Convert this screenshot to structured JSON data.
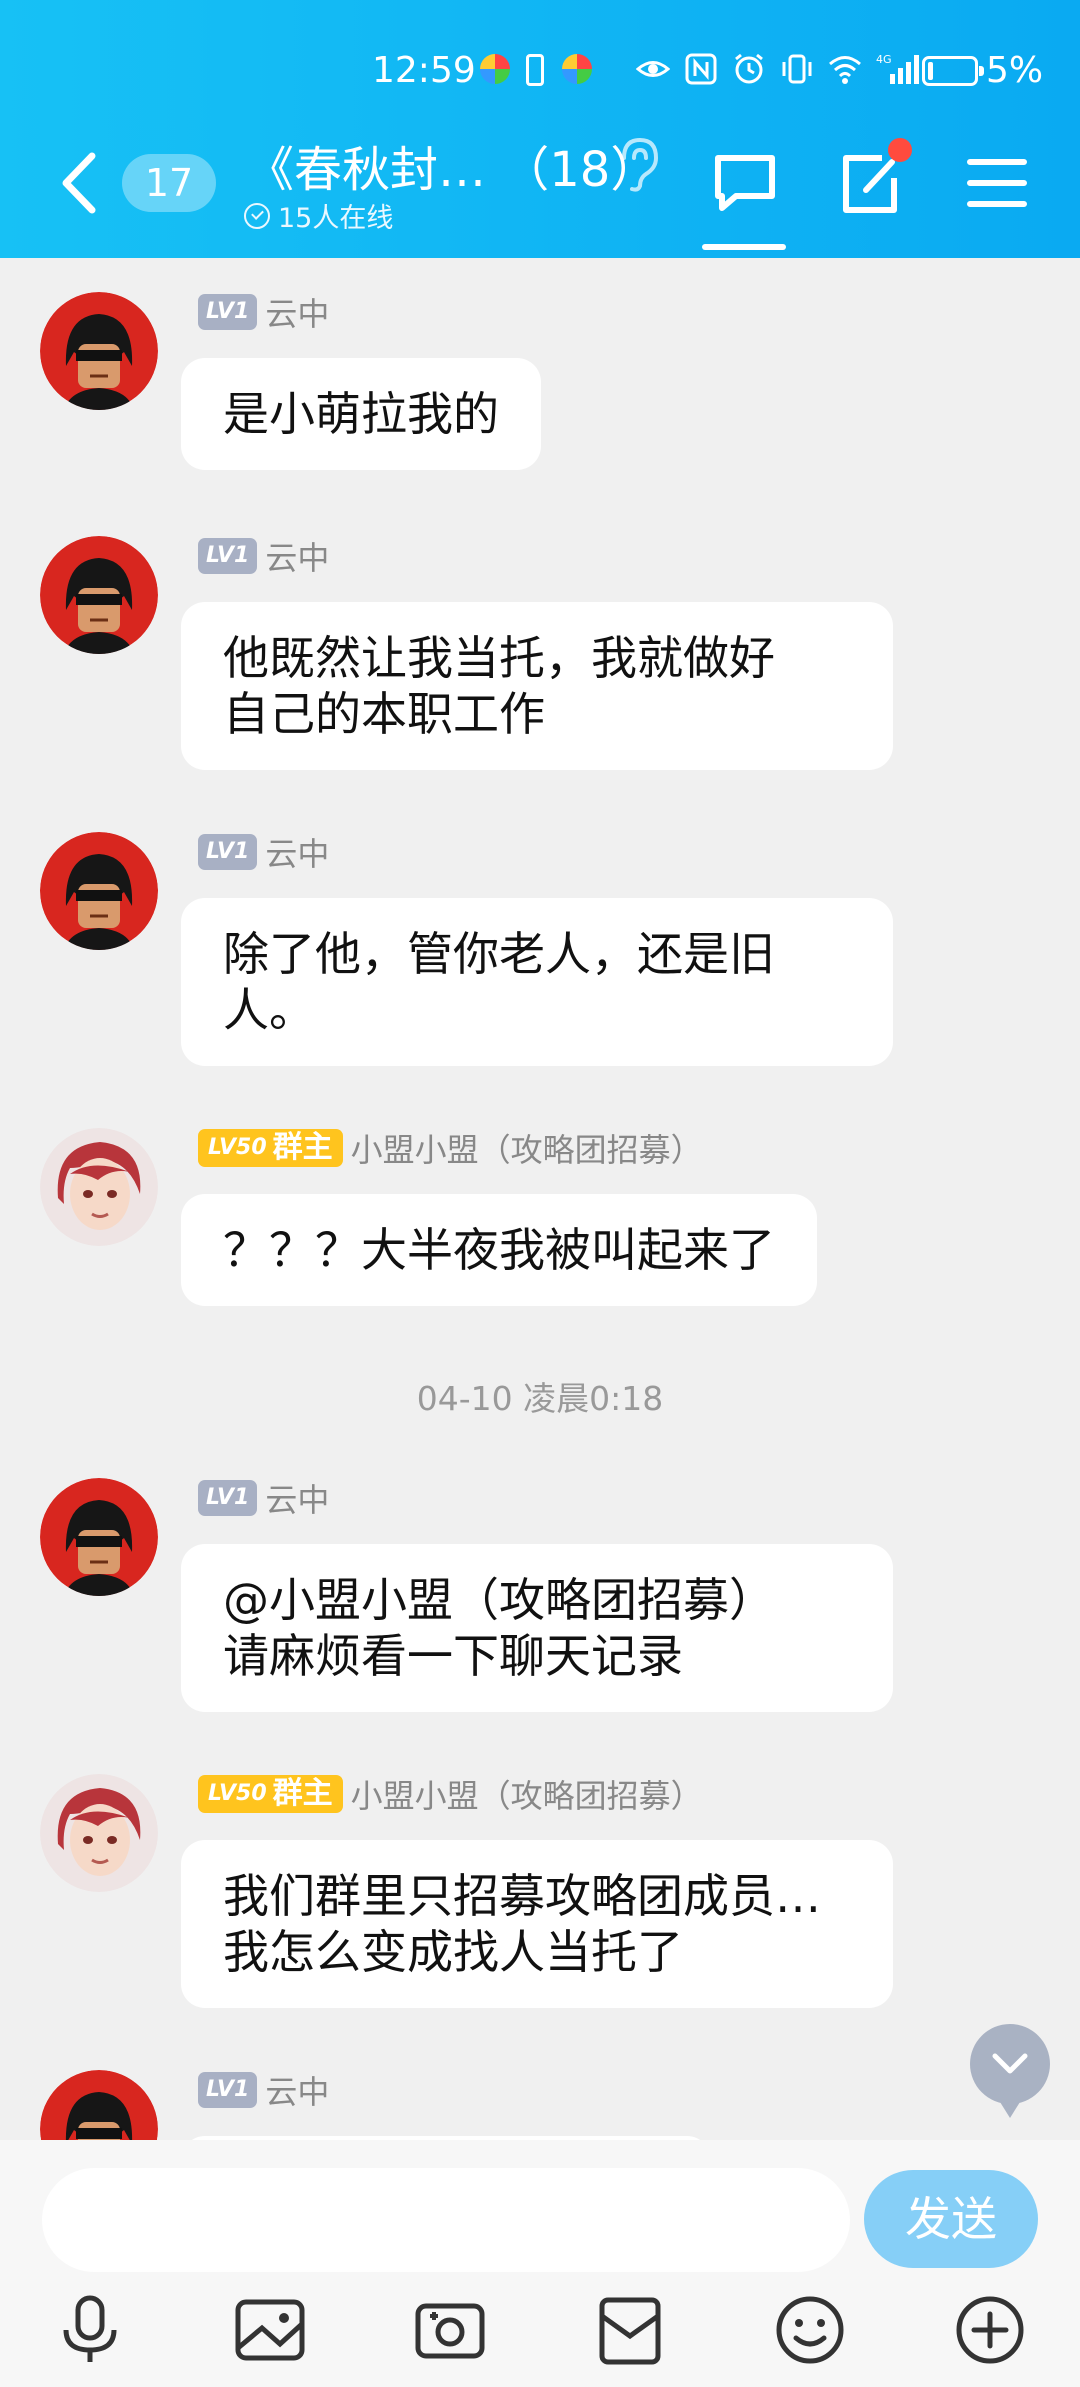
{
  "status_bar": {
    "time": "12:59",
    "battery": "5%",
    "network": "4G"
  },
  "header": {
    "unread_count": "17",
    "title": "《春秋封…  （18）",
    "online": "15人在线",
    "brand_color": "#12b7f5"
  },
  "messages": [
    {
      "type": "msg",
      "level": "LV1",
      "sender": "云中",
      "avatar": "pixel-avatar",
      "text": "是小萌拉我的"
    },
    {
      "type": "msg",
      "level": "LV1",
      "sender": "云中",
      "avatar": "pixel-avatar",
      "lines": [
        "他既然让我当托，我就做好",
        "自己的本职工作"
      ]
    },
    {
      "type": "msg",
      "level": "LV1",
      "sender": "云中",
      "avatar": "pixel-avatar",
      "lines": [
        "除了他，管你老人，还是旧",
        "人。"
      ]
    },
    {
      "type": "msg",
      "level": "LV50",
      "role": "群主",
      "sender": "小盟小盟（攻略团招募）",
      "avatar": "anime-avatar",
      "text": "？？？大半夜我被叫起来了"
    },
    {
      "type": "time",
      "text": "04-10 凌晨0:18"
    },
    {
      "type": "msg",
      "level": "LV1",
      "sender": "云中",
      "avatar": "pixel-avatar",
      "lines": [
        "@小盟小盟（攻略团招募）",
        "请麻烦看一下聊天记录"
      ]
    },
    {
      "type": "msg",
      "level": "LV50",
      "role": "群主",
      "sender": "小盟小盟（攻略团招募）",
      "avatar": "anime-avatar",
      "lines": [
        "我们群里只招募攻略团成员…",
        "我怎么变成找人当托了"
      ]
    },
    {
      "type": "msg",
      "level": "LV1",
      "sender": "云中",
      "avatar": "pixel-avatar"
    }
  ],
  "input": {
    "placeholder": "",
    "send_label": "发送"
  },
  "toolbar": [
    "microphone-icon",
    "image-icon",
    "camera-icon",
    "red-packet-icon",
    "emoji-icon",
    "plus-icon"
  ]
}
